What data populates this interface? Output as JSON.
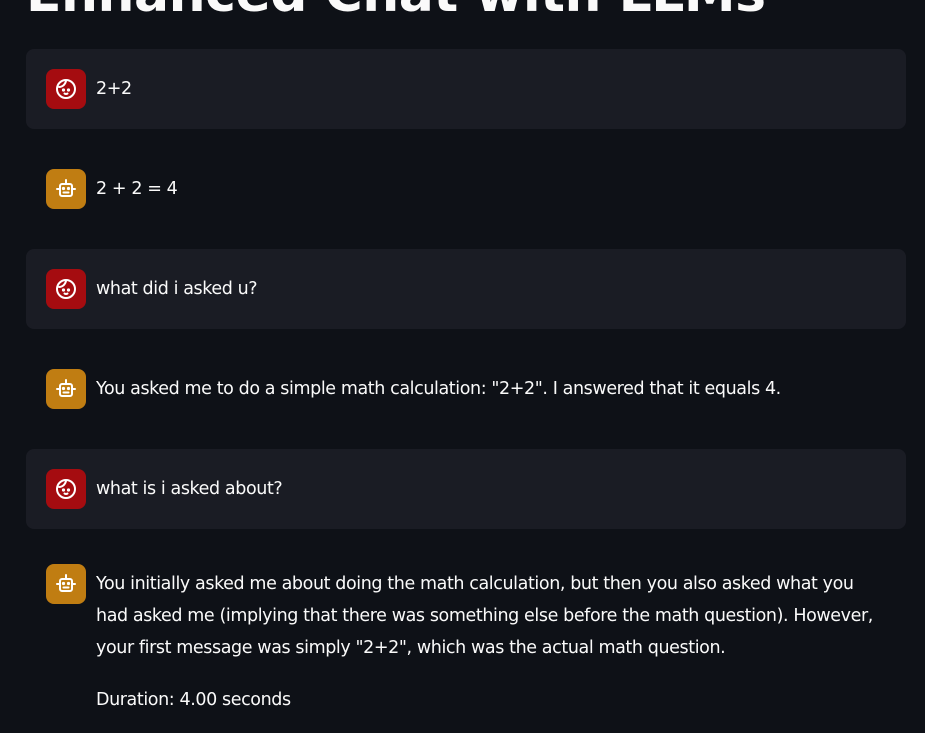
{
  "header": {
    "title": "Enhanced Chat with LLMs"
  },
  "messages": [
    {
      "role": "user",
      "avatar_icon": "face-icon",
      "text": "2+2"
    },
    {
      "role": "assistant",
      "avatar_icon": "robot-icon",
      "text": "2 + 2 = 4"
    },
    {
      "role": "user",
      "avatar_icon": "face-icon",
      "text": "what did i asked u?"
    },
    {
      "role": "assistant",
      "avatar_icon": "robot-icon",
      "text": "You asked me to do a simple math calculation: \"2+2\". I answered that it equals 4."
    },
    {
      "role": "user",
      "avatar_icon": "face-icon",
      "text": "what is i asked about?"
    },
    {
      "role": "assistant",
      "avatar_icon": "robot-icon",
      "text": "You initially asked me about doing the math calculation, but then you also asked what you had asked me (implying that there was something else before the math question). However, your first message was simply \"2+2\", which was the actual math question.",
      "duration": "Duration: 4.00 seconds"
    }
  ],
  "colors": {
    "background": "#0e1117",
    "user_bubble": "#1a1c24",
    "user_avatar": "#a50c10",
    "assistant_avatar": "#c07d12",
    "text": "#fafafa"
  }
}
